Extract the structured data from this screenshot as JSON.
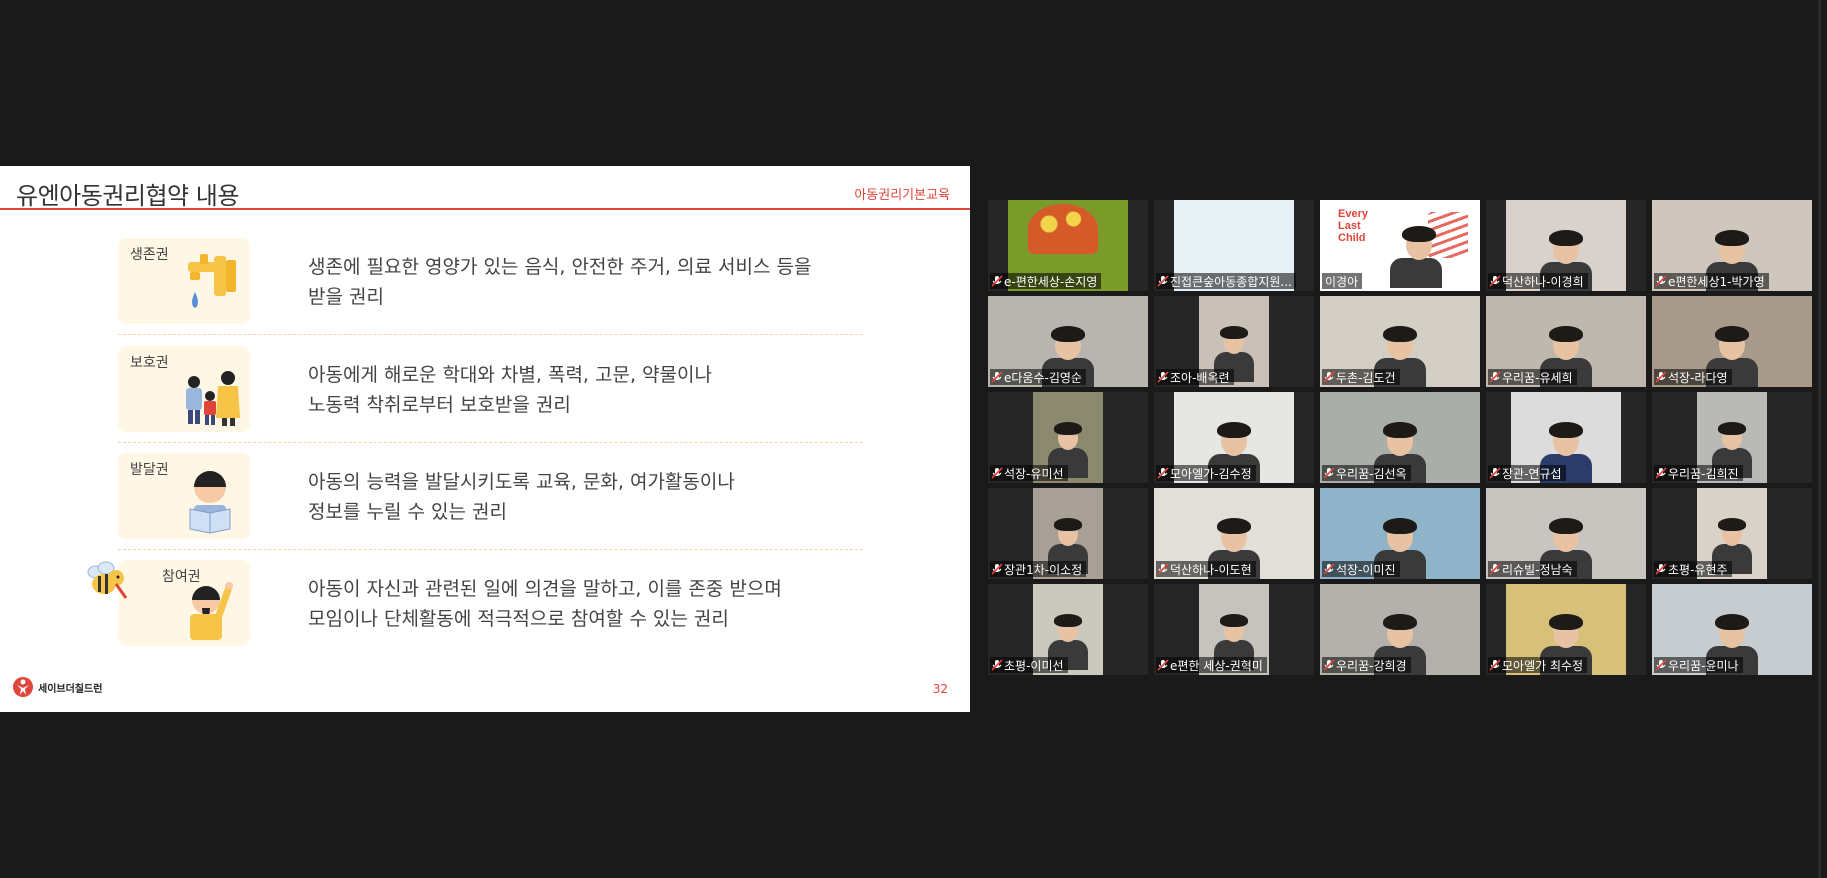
{
  "slide": {
    "title": "유엔아동권리협약 내용",
    "tag": "아동권리기본교육",
    "page_number": "32",
    "brand_name": "세이브더칠드런",
    "rights": [
      {
        "label": "생존권",
        "line1": "생존에 필요한 영양가 있는 음식, 안전한 주거, 의료 서비스 등을",
        "line2": "받을 권리"
      },
      {
        "label": "보호권",
        "line1": "아동에게 해로운 학대와 차별, 폭력, 고문, 약물이나",
        "line2": "노동력 착취로부터 보호받을 권리"
      },
      {
        "label": "발달권",
        "line1": "아동의 능력을 발달시키도록 교육, 문화, 여가활동이나",
        "line2": "정보를 누릴 수 있는 권리"
      },
      {
        "label": "참여권",
        "line1": "아동이 자신과 관련된 일에 의견을 말하고, 이를 존중 받으며",
        "line2": "모임이나 단체활동에 적극적으로 참여할 수 있는 권리"
      }
    ]
  },
  "participants": [
    {
      "name": "e-편한세상-손지영",
      "bg": "#7a9a2a"
    },
    {
      "name": "진접큰숲아동종합지원...",
      "bg": "#e8f1f6"
    },
    {
      "name": "이경아",
      "bg": "#ffffff"
    },
    {
      "name": "덕산하나-이경희",
      "bg": "#d9d2cc"
    },
    {
      "name": "e편한세상1-박가영",
      "bg": "#cfc6bd"
    },
    {
      "name": "e다움수-김영순",
      "bg": "#b8b5b0"
    },
    {
      "name": "조아-배옥련",
      "bg": "#c9c1b8"
    },
    {
      "name": "두촌-김도건",
      "bg": "#d4cfc4"
    },
    {
      "name": "우리꿈-유세희",
      "bg": "#bfb8ae"
    },
    {
      "name": "석장-라다영",
      "bg": "#a79a8a"
    },
    {
      "name": "석장-유미선",
      "bg": "#8c8a6e"
    },
    {
      "name": "모아엘가-김수정",
      "bg": "#e6e6e2"
    },
    {
      "name": "우리꿈-김선옥",
      "bg": "#a9aea8"
    },
    {
      "name": "장관-연규섭",
      "bg": "#dcdcdc"
    },
    {
      "name": "우리꿈-김희진",
      "bg": "#b9b9b5"
    },
    {
      "name": "장관1차-이소정",
      "bg": "#a89f96"
    },
    {
      "name": "덕산하나-이도현",
      "bg": "#e2dfd8"
    },
    {
      "name": "석장-이미진",
      "bg": "#8fb3c8"
    },
    {
      "name": "리슈빌-정남숙",
      "bg": "#c8c5c0"
    },
    {
      "name": "초평-유현주",
      "bg": "#d8d2c8"
    },
    {
      "name": "초평-이미선",
      "bg": "#cbc8bd"
    },
    {
      "name": "e편한 세상-권혁미",
      "bg": "#c6c2bc"
    },
    {
      "name": "우리꿈-강희경",
      "bg": "#b4b1ac"
    },
    {
      "name": "모아엘가 최수정",
      "bg": "#d6c07a"
    },
    {
      "name": "우리꿈-윤미나",
      "bg": "#c7ccd0"
    }
  ],
  "active_speaker_poster": {
    "line1": "Every",
    "line2": "Last",
    "line3": "Child"
  },
  "colors": {
    "accent": "#e0453a",
    "active_outline": "#c9d63a",
    "mic_muted": "#e0453a"
  }
}
